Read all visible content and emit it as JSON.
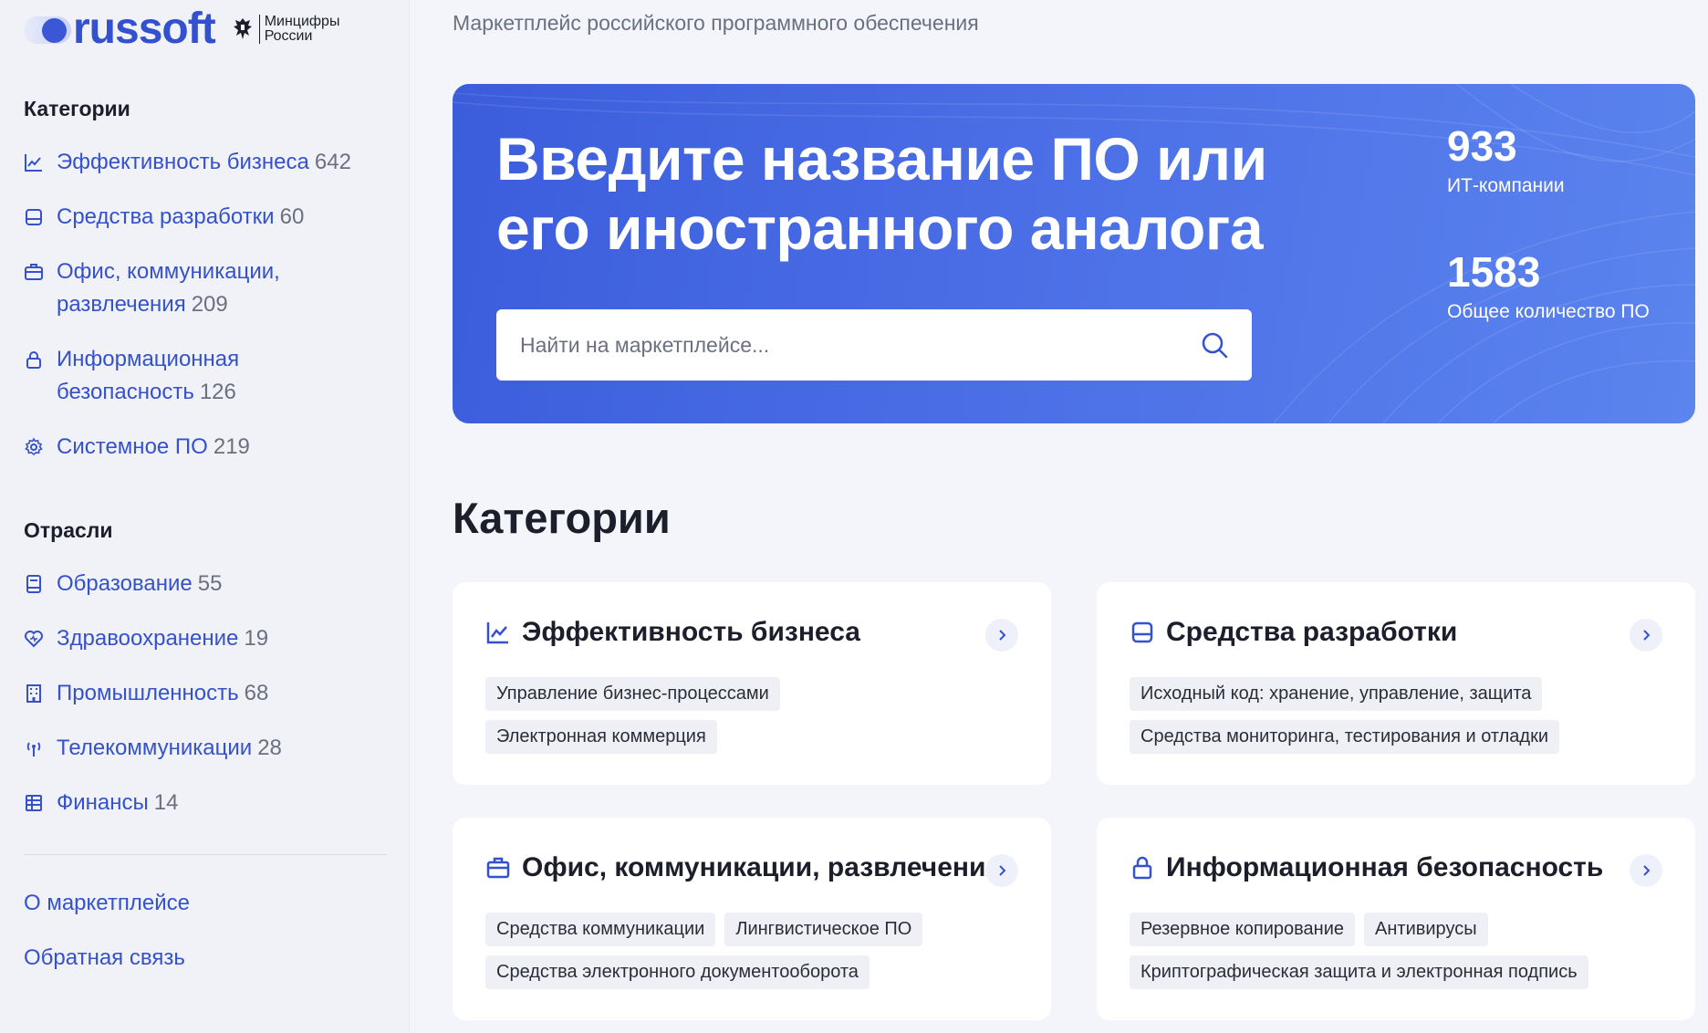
{
  "brand": {
    "name": "russoft",
    "ministry_line1": "Минцифры",
    "ministry_line2": "России"
  },
  "tagline": "Маркетплейс российского программного обеспечения",
  "sidebar": {
    "categories_title": "Категории",
    "categories": [
      {
        "icon": "chart-line-icon",
        "label": "Эффективность бизнеса",
        "count": "642"
      },
      {
        "icon": "hard-drive-icon",
        "label": "Средства разработки",
        "count": "60"
      },
      {
        "icon": "briefcase-icon",
        "label": "Офис, коммуникации,",
        "label2": "развлечения",
        "count": "209"
      },
      {
        "icon": "lock-icon",
        "label": "Информационная",
        "label2": "безопасность",
        "count": "126"
      },
      {
        "icon": "gear-icon",
        "label": "Системное ПО",
        "count": "219"
      }
    ],
    "industries_title": "Отрасли",
    "industries": [
      {
        "icon": "book-icon",
        "label": "Образование",
        "count": "55"
      },
      {
        "icon": "heart-icon",
        "label": "Здравоохранение",
        "count": "19"
      },
      {
        "icon": "building-icon",
        "label": "Промышленность",
        "count": "68"
      },
      {
        "icon": "antenna-icon",
        "label": "Телекоммуникации",
        "count": "28"
      },
      {
        "icon": "bank-icon",
        "label": "Финансы",
        "count": "14"
      }
    ],
    "footer_links": [
      "О маркетплейсе",
      "Обратная связь"
    ]
  },
  "hero": {
    "title_line1": "Введите название ПО или",
    "title_line2": "его иностранного аналога",
    "search_placeholder": "Найти на маркетплейсе...",
    "search_value": "",
    "stats": [
      {
        "value": "933",
        "label": "ИТ-компании"
      },
      {
        "value": "1583",
        "label": "Общее количество ПО"
      }
    ]
  },
  "categories_section": {
    "heading": "Категории",
    "cards": [
      {
        "icon": "chart-line-icon",
        "title": "Эффективность бизнеса",
        "tags": [
          "Управление бизнес-процессами",
          "Электронная коммерция"
        ]
      },
      {
        "icon": "hard-drive-icon",
        "title": "Средства разработки",
        "tags": [
          "Исходный код: хранение, управление, защита",
          "Средства мониторинга, тестирования и отладки"
        ]
      },
      {
        "icon": "briefcase-icon",
        "title": "Офис, коммуникации, развлечения",
        "tags": [
          "Средства коммуникации",
          "Лингвистическое ПО",
          "Средства электронного документооборота"
        ]
      },
      {
        "icon": "lock-icon",
        "title": "Информационная безопасность",
        "tags": [
          "Резервное копирование",
          "Антивирусы",
          "Криптографическая защита и электронная подпись"
        ]
      }
    ]
  },
  "colors": {
    "accent": "#3551cc",
    "hero_start": "#3b5ddc",
    "hero_end": "#5b84ee",
    "background": "#f3f5fa"
  }
}
